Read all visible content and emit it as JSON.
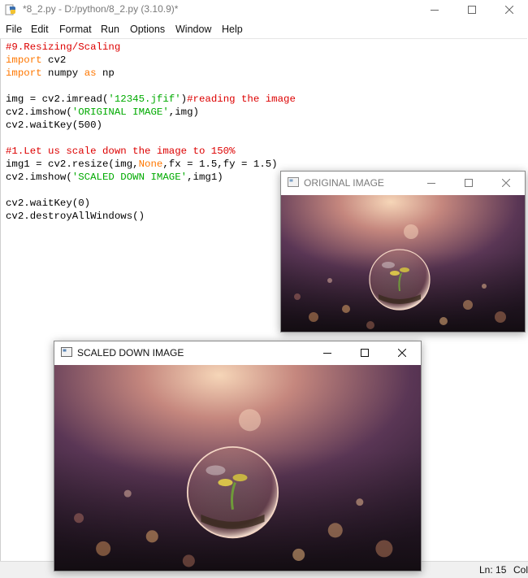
{
  "window": {
    "title": "*8_2.py - D:/python/8_2.py (3.10.9)*",
    "app_icon": "python-icon",
    "controls": [
      "minimize-icon",
      "maximize-icon",
      "close-icon"
    ]
  },
  "menu": [
    {
      "label": "File"
    },
    {
      "label": "Edit"
    },
    {
      "label": "Format"
    },
    {
      "label": "Run"
    },
    {
      "label": "Options"
    },
    {
      "label": "Window"
    },
    {
      "label": "Help"
    }
  ],
  "code": {
    "lines": [
      [
        {
          "t": "#9.Resizing/Scaling",
          "c": "com"
        }
      ],
      [
        {
          "t": "import",
          "c": "kw"
        },
        {
          "t": " cv2"
        }
      ],
      [
        {
          "t": "import",
          "c": "kw"
        },
        {
          "t": " numpy "
        },
        {
          "t": "as",
          "c": "kw"
        },
        {
          "t": " np"
        }
      ],
      [],
      [
        {
          "t": "img = cv2.imread("
        },
        {
          "t": "'12345.jfif'",
          "c": "str"
        },
        {
          "t": ")"
        },
        {
          "t": "#reading the image",
          "c": "com"
        }
      ],
      [
        {
          "t": "cv2.imshow("
        },
        {
          "t": "'ORIGINAL IMAGE'",
          "c": "str"
        },
        {
          "t": ",img)"
        }
      ],
      [
        {
          "t": "cv2.waitKey(500)"
        }
      ],
      [],
      [
        {
          "t": "#1.Let us scale down the image to 150%",
          "c": "com"
        }
      ],
      [
        {
          "t": "img1 = cv2.resize(img,"
        },
        {
          "t": "None",
          "c": "kw"
        },
        {
          "t": ",fx = 1.5,fy = 1.5)"
        }
      ],
      [
        {
          "t": "cv2.imshow("
        },
        {
          "t": "'SCALED DOWN IMAGE'",
          "c": "str"
        },
        {
          "t": ",img1)"
        }
      ],
      [],
      [
        {
          "t": "cv2.waitKey(0)"
        }
      ],
      [
        {
          "t": "cv2.destroyAllWindows()"
        }
      ]
    ]
  },
  "status": {
    "line": "Ln: 15",
    "col": "Col"
  },
  "cv_windows": {
    "original": {
      "title": "ORIGINAL IMAGE",
      "active": false
    },
    "scaled": {
      "title": "SCALED DOWN IMAGE",
      "active": true
    }
  },
  "colors": {
    "comment": "#dd0000",
    "keyword": "#ff7700",
    "string": "#00aa00",
    "inactive_title": "#7a7a7a"
  }
}
